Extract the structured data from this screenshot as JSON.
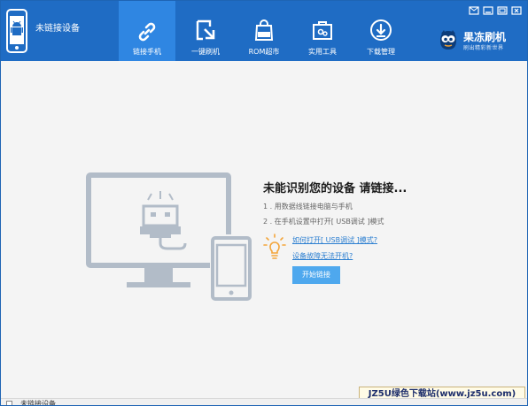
{
  "device": {
    "status_label": "未链接设备",
    "icon": "android-phone-icon"
  },
  "nav": {
    "items": [
      {
        "label": "链接手机",
        "icon": "link-icon",
        "active": true
      },
      {
        "label": "一键刷机",
        "icon": "flash-download-icon",
        "active": false
      },
      {
        "label": "ROM超市",
        "icon": "rom-bag-icon",
        "active": false
      },
      {
        "label": "实用工具",
        "icon": "toolbox-icon",
        "active": false
      },
      {
        "label": "下载管理",
        "icon": "download-icon",
        "active": false
      }
    ]
  },
  "window_controls": [
    "message-icon",
    "minimize-icon",
    "maximize-icon",
    "close-icon"
  ],
  "brand": {
    "name": "果冻刷机",
    "slogan": "刷出精彩新世界"
  },
  "main": {
    "title": "未能识别您的设备 请链接...",
    "step1": "1 . 用数据线链接电脑与手机",
    "step2": "2 . 在手机设置中打开[ USB调试 ]模式",
    "link_usb": "如何打开[ USB调试 ]模式?",
    "link_boot": "设备故障无法开机?",
    "connect_button": "开始链接"
  },
  "statusbar": {
    "text": "未链接设备"
  },
  "watermark": "JZ5U绿色下载站(www.jz5u.com)",
  "colors": {
    "header": "#1f6cc4",
    "active_tab": "#2f86e2",
    "link": "#2c7fd1",
    "button": "#4ea8ee",
    "illustration": "#b2bcc8"
  }
}
